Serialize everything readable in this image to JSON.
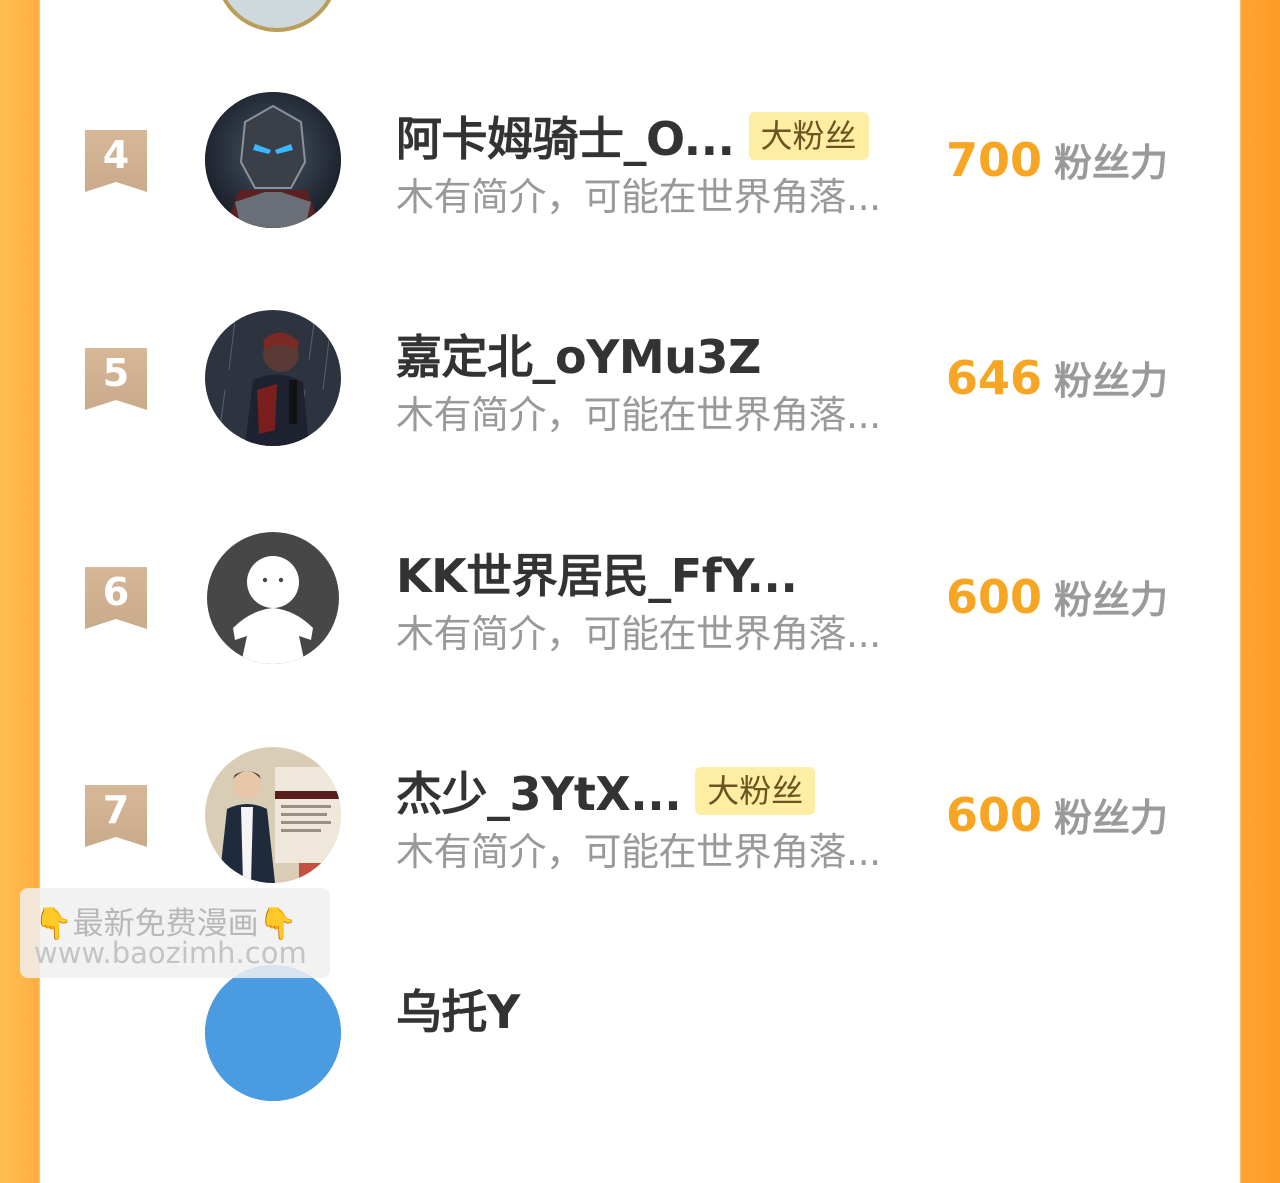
{
  "ranking": {
    "score_unit": "粉丝力",
    "entries": [
      {
        "rank": "4",
        "name": "阿卡姆骑士_O...",
        "tag": "大粉丝",
        "intro": "木有简介，可能在世界角落...",
        "score": "700",
        "avatar_icon": "armored-knight-avatar"
      },
      {
        "rank": "5",
        "name": "嘉定北_oYMu3Z",
        "tag": "",
        "intro": "木有简介，可能在世界角落...",
        "score": "646",
        "avatar_icon": "rain-figure-avatar"
      },
      {
        "rank": "6",
        "name": "KK世界居民_FfY...",
        "tag": "",
        "intro": "木有简介，可能在世界角落...",
        "score": "600",
        "avatar_icon": "default-user-avatar"
      },
      {
        "rank": "7",
        "name": "杰少_3YtX...",
        "tag": "大粉丝",
        "intro": "木有简介，可能在世界角落...",
        "score": "600",
        "avatar_icon": "fashion-model-avatar"
      },
      {
        "rank": "",
        "name": "乌托Y",
        "tag": "",
        "intro": "",
        "score": "",
        "avatar_icon": "blue-avatar"
      }
    ]
  },
  "watermark": {
    "line1": "最新免费漫画",
    "hand": "👇",
    "line2": "www.baozimh.com"
  },
  "colors": {
    "accent": "#f6a623",
    "badge": "#c9a88a",
    "tag_bg": "#fdeea3",
    "side_gradient": "#ffa635"
  }
}
